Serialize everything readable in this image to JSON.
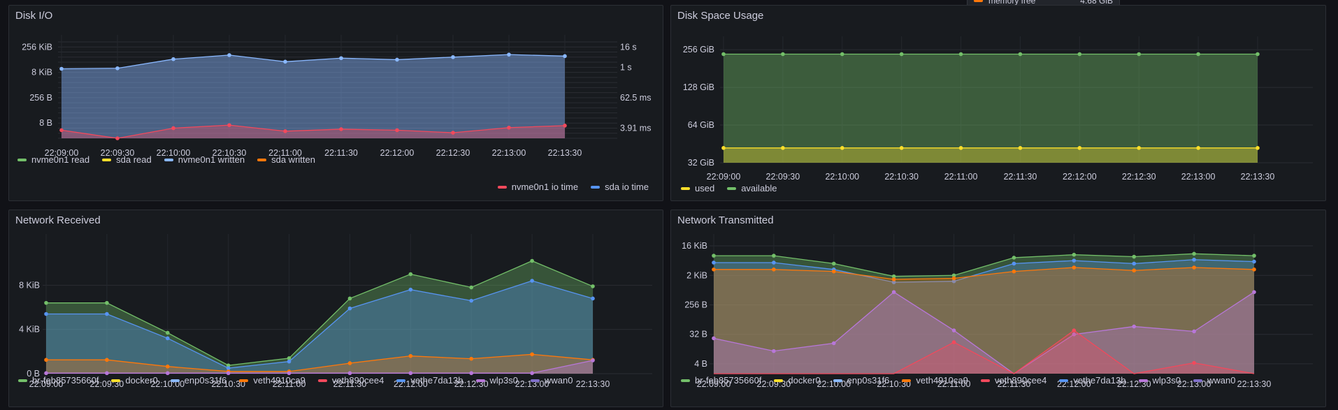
{
  "colors": {
    "green": "#73bf69",
    "yellow": "#fade2a",
    "lightblue": "#8ab8ff",
    "orange": "#ff780a",
    "red": "#f2495c",
    "blue": "#5794f2",
    "purple": "#b877d9",
    "darkpurple": "#8f3bb8",
    "violet": "#7f6fc9"
  },
  "tooltip": {
    "label": "memory free",
    "value": "4.68 GiB"
  },
  "panels": {
    "disk_io": {
      "title": "Disk I/O",
      "legend_top": [
        {
          "name": "nvme0n1 read",
          "color": "#73bf69"
        },
        {
          "name": "sda read",
          "color": "#fade2a"
        },
        {
          "name": "nvme0n1 written",
          "color": "#8ab8ff"
        },
        {
          "name": "sda written",
          "color": "#ff780a"
        }
      ],
      "legend_bottom": [
        {
          "name": "nvme0n1 io time",
          "color": "#f2495c"
        },
        {
          "name": "sda io time",
          "color": "#5794f2"
        }
      ]
    },
    "disk_space": {
      "title": "Disk Space Usage",
      "legend": [
        {
          "name": "used",
          "color": "#fade2a"
        },
        {
          "name": "available",
          "color": "#73bf69"
        }
      ]
    },
    "net_rx": {
      "title": "Network Received",
      "legend": [
        {
          "name": "br-feb85735660f",
          "color": "#73bf69"
        },
        {
          "name": "docker0",
          "color": "#fade2a"
        },
        {
          "name": "enp0s31f6",
          "color": "#8ab8ff"
        },
        {
          "name": "veth4910ca9",
          "color": "#ff780a"
        },
        {
          "name": "veth890cee4",
          "color": "#f2495c"
        },
        {
          "name": "vethe7da13b",
          "color": "#5794f2"
        },
        {
          "name": "wlp3s0",
          "color": "#b877d9"
        },
        {
          "name": "wwan0",
          "color": "#7f6fc9"
        }
      ]
    },
    "net_tx": {
      "title": "Network Transmitted",
      "legend": [
        {
          "name": "br-feb85735660f",
          "color": "#73bf69"
        },
        {
          "name": "docker0",
          "color": "#fade2a"
        },
        {
          "name": "enp0s31f6",
          "color": "#8ab8ff"
        },
        {
          "name": "veth4910ca9",
          "color": "#ff780a"
        },
        {
          "name": "veth890cee4",
          "color": "#f2495c"
        },
        {
          "name": "vethe7da13b",
          "color": "#5794f2"
        },
        {
          "name": "wlp3s0",
          "color": "#b877d9"
        },
        {
          "name": "wwan0",
          "color": "#7f6fc9"
        }
      ]
    }
  },
  "chart_data": [
    {
      "id": "disk_io",
      "type": "area",
      "title": "Disk I/O",
      "scale": "log",
      "x": [
        "22:09:00",
        "22:09:30",
        "22:10:00",
        "22:10:30",
        "22:11:00",
        "22:11:30",
        "22:12:00",
        "22:12:30",
        "22:13:00",
        "22:13:30"
      ],
      "y_ticks_left": [
        "256 KiB",
        "8 KiB",
        "256 B",
        "8 B"
      ],
      "y_ticks_right": [
        "16 s",
        "1 s",
        "62.5 ms",
        "3.91 ms"
      ],
      "ylim_log2": [
        0,
        19
      ],
      "series": [
        {
          "name": "nvme0n1 written",
          "color": "#8ab8ff",
          "values_log2": [
            13.7,
            13.8,
            15.6,
            16.4,
            15.1,
            15.8,
            15.5,
            16.0,
            16.5,
            16.2
          ]
        },
        {
          "name": "nvme0n1 io time",
          "color": "#f2495c",
          "values_log2": [
            1.6,
            0.0,
            2.0,
            2.6,
            1.4,
            1.8,
            1.6,
            1.1,
            2.1,
            2.5
          ]
        }
      ]
    },
    {
      "id": "disk_space",
      "type": "area",
      "title": "Disk Space Usage",
      "scale": "log",
      "x": [
        "22:09:00",
        "22:09:30",
        "22:10:00",
        "22:10:30",
        "22:11:00",
        "22:11:30",
        "22:12:00",
        "22:12:30",
        "22:13:00",
        "22:13:30"
      ],
      "y_ticks": [
        "256 GiB",
        "128 GiB",
        "64 GiB",
        "32 GiB"
      ],
      "ylim_gib": [
        32,
        256
      ],
      "series": [
        {
          "name": "available",
          "color": "#73bf69",
          "values_gib": [
            236,
            236,
            236,
            236,
            236,
            236,
            236,
            236,
            236,
            236
          ]
        },
        {
          "name": "used",
          "color": "#fade2a",
          "values_gib": [
            42,
            42,
            42,
            42,
            42,
            42,
            42,
            42,
            42,
            42
          ]
        }
      ]
    },
    {
      "id": "net_rx",
      "type": "area",
      "title": "Network Received",
      "x": [
        "22:09:00",
        "22:09:30",
        "22:10:00",
        "22:10:30",
        "22:11:00",
        "22:11:30",
        "22:12:00",
        "22:12:30",
        "22:13:00",
        "22:13:30"
      ],
      "y_ticks": [
        "8 KiB",
        "4 KiB",
        "0 B"
      ],
      "ylim_kib": [
        0,
        12
      ],
      "series": [
        {
          "name": "br-feb85735660f",
          "color": "#73bf69",
          "values_kib": [
            6.4,
            6.4,
            3.7,
            0.75,
            1.4,
            6.8,
            9.0,
            7.8,
            10.2,
            7.9
          ]
        },
        {
          "name": "vethe7da13b",
          "color": "#5794f2",
          "values_kib": [
            5.4,
            5.4,
            3.2,
            0.5,
            1.1,
            5.9,
            7.6,
            6.6,
            8.4,
            6.8
          ]
        },
        {
          "name": "veth4910ca9",
          "color": "#ff780a",
          "values_kib": [
            1.25,
            1.25,
            0.65,
            0.2,
            0.2,
            0.95,
            1.6,
            1.35,
            1.75,
            1.25
          ]
        },
        {
          "name": "wlp3s0",
          "color": "#b877d9",
          "values_kib": [
            0.05,
            0.05,
            0.05,
            0.05,
            0.05,
            0.05,
            0.05,
            0.05,
            0.05,
            1.2
          ]
        }
      ]
    },
    {
      "id": "net_tx",
      "type": "area",
      "title": "Network Transmitted",
      "scale": "log",
      "x": [
        "22:09:00",
        "22:09:30",
        "22:10:00",
        "22:10:30",
        "22:11:00",
        "22:11:30",
        "22:12:00",
        "22:12:30",
        "22:13:00",
        "22:13:30"
      ],
      "y_ticks": [
        "16 KiB",
        "2 KiB",
        "256 B",
        "32 B",
        "4 B"
      ],
      "ylim_log2": [
        1,
        14
      ],
      "series": [
        {
          "name": "br-feb85735660f",
          "color": "#73bf69",
          "values_log2": [
            13.0,
            13.0,
            12.2,
            10.9,
            11.0,
            12.8,
            13.1,
            12.9,
            13.2,
            13.0
          ]
        },
        {
          "name": "vethe7da13b",
          "color": "#5794f2",
          "values_log2": [
            12.3,
            12.3,
            11.6,
            10.3,
            10.4,
            12.2,
            12.5,
            12.2,
            12.6,
            12.4
          ]
        },
        {
          "name": "veth4910ca9",
          "color": "#ff780a",
          "values_log2": [
            11.6,
            11.6,
            11.4,
            10.6,
            10.7,
            11.4,
            11.8,
            11.5,
            11.8,
            11.6
          ]
        },
        {
          "name": "wlp3s0",
          "color": "#b877d9",
          "values_log2": [
            4.6,
            3.3,
            4.1,
            9.3,
            5.4,
            0.0,
            5.0,
            5.8,
            5.3,
            9.3
          ]
        },
        {
          "name": "veth890cee4",
          "color": "#f2495c",
          "values_log2": [
            0.0,
            0.0,
            0.0,
            0.0,
            4.2,
            0.0,
            5.4,
            0.0,
            2.1,
            0.0
          ]
        }
      ]
    }
  ]
}
